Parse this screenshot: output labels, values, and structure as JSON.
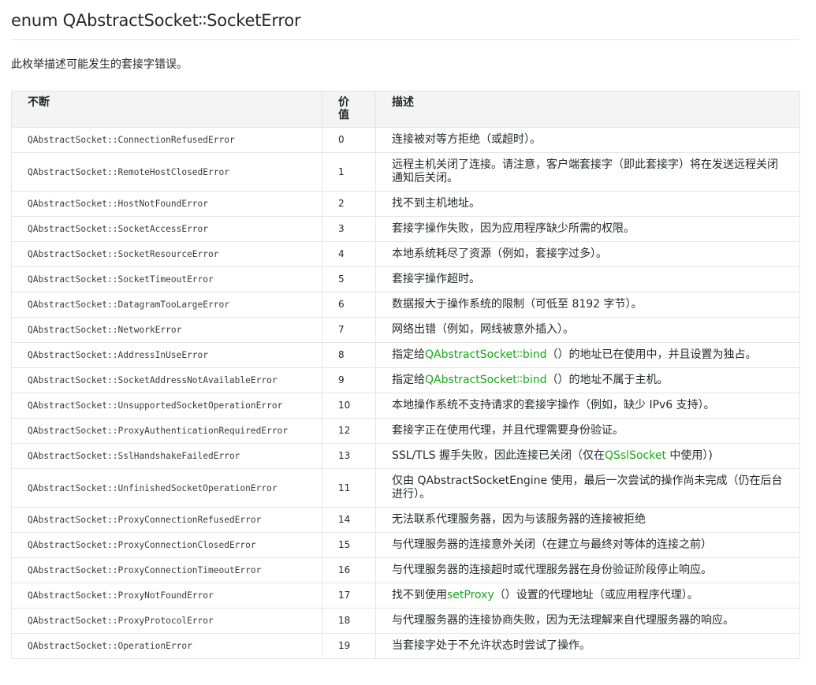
{
  "header": {
    "title": "enum QAbstractSocket∶∶SocketError",
    "intro": "此枚举描述可能发生的套接字错误。"
  },
  "table": {
    "columns": [
      "不断",
      "价值",
      "描述"
    ],
    "rows": [
      {
        "constant": "QAbstractSocket::ConnectionRefusedError",
        "value": "0",
        "desc": "连接被对等方拒绝（或超时）。"
      },
      {
        "constant": "QAbstractSocket::RemoteHostClosedError",
        "value": "1",
        "desc": "远程主机关闭了连接。请注意，客户端套接字（即此套接字）将在发送远程关闭通知后关闭。"
      },
      {
        "constant": "QAbstractSocket::HostNotFoundError",
        "value": "2",
        "desc": "找不到主机地址。"
      },
      {
        "constant": "QAbstractSocket::SocketAccessError",
        "value": "3",
        "desc": "套接字操作失败，因为应用程序缺少所需的权限。"
      },
      {
        "constant": "QAbstractSocket::SocketResourceError",
        "value": "4",
        "desc": "本地系统耗尽了资源（例如，套接字过多）。"
      },
      {
        "constant": "QAbstractSocket::SocketTimeoutError",
        "value": "5",
        "desc": "套接字操作超时。"
      },
      {
        "constant": "QAbstractSocket::DatagramTooLargeError",
        "value": "6",
        "desc": "数据报大于操作系统的限制（可低至 8192 字节）。"
      },
      {
        "constant": "QAbstractSocket::NetworkError",
        "value": "7",
        "desc": "网络出错（例如，网线被意外插入）。"
      },
      {
        "constant": "QAbstractSocket::AddressInUseError",
        "value": "8",
        "desc_pre": "指定给",
        "desc_link": "QAbstractSocket∶∶bind",
        "desc_post": "（）的地址已在使用中，并且设置为独占。"
      },
      {
        "constant": "QAbstractSocket::SocketAddressNotAvailableError",
        "value": "9",
        "desc_pre": "指定给",
        "desc_link": "QAbstractSocket∶∶bind",
        "desc_post": "（）的地址不属于主机。"
      },
      {
        "constant": "QAbstractSocket::UnsupportedSocketOperationError",
        "value": "10",
        "desc": "本地操作系统不支持请求的套接字操作（例如，缺少 IPv6 支持）。"
      },
      {
        "constant": "QAbstractSocket::ProxyAuthenticationRequiredError",
        "value": "12",
        "desc": "套接字正在使用代理，并且代理需要身份验证。"
      },
      {
        "constant": "QAbstractSocket::SslHandshakeFailedError",
        "value": "13",
        "desc_pre": "SSL/TLS 握手失败，因此连接已关闭（仅在",
        "desc_link": "QSslSocket",
        "desc_post": " 中使用）)"
      },
      {
        "constant": "QAbstractSocket::UnfinishedSocketOperationError",
        "value": "11",
        "desc": "仅由 QAbstractSocketEngine 使用，最后一次尝试的操作尚未完成（仍在后台进行）。"
      },
      {
        "constant": "QAbstractSocket::ProxyConnectionRefusedError",
        "value": "14",
        "desc": "无法联系代理服务器，因为与该服务器的连接被拒绝"
      },
      {
        "constant": "QAbstractSocket::ProxyConnectionClosedError",
        "value": "15",
        "desc": "与代理服务器的连接意外关闭（在建立与最终对等体的连接之前）"
      },
      {
        "constant": "QAbstractSocket::ProxyConnectionTimeoutError",
        "value": "16",
        "desc": "与代理服务器的连接超时或代理服务器在身份验证阶段停止响应。"
      },
      {
        "constant": "QAbstractSocket::ProxyNotFoundError",
        "value": "17",
        "desc_pre": "找不到使用",
        "desc_link": "setProxy",
        "desc_post": "（）设置的代理地址（或应用程序代理）。"
      },
      {
        "constant": "QAbstractSocket::ProxyProtocolError",
        "value": "18",
        "desc": "与代理服务器的连接协商失败，因为无法理解来自代理服务器的响应。"
      },
      {
        "constant": "QAbstractSocket::OperationError",
        "value": "19",
        "desc": "当套接字处于不允许状态时尝试了操作。"
      }
    ]
  },
  "colors": {
    "link": "#17a81a",
    "header_bg": "#f4f4f4",
    "border": "#e3e3e3",
    "text": "#26282a"
  }
}
